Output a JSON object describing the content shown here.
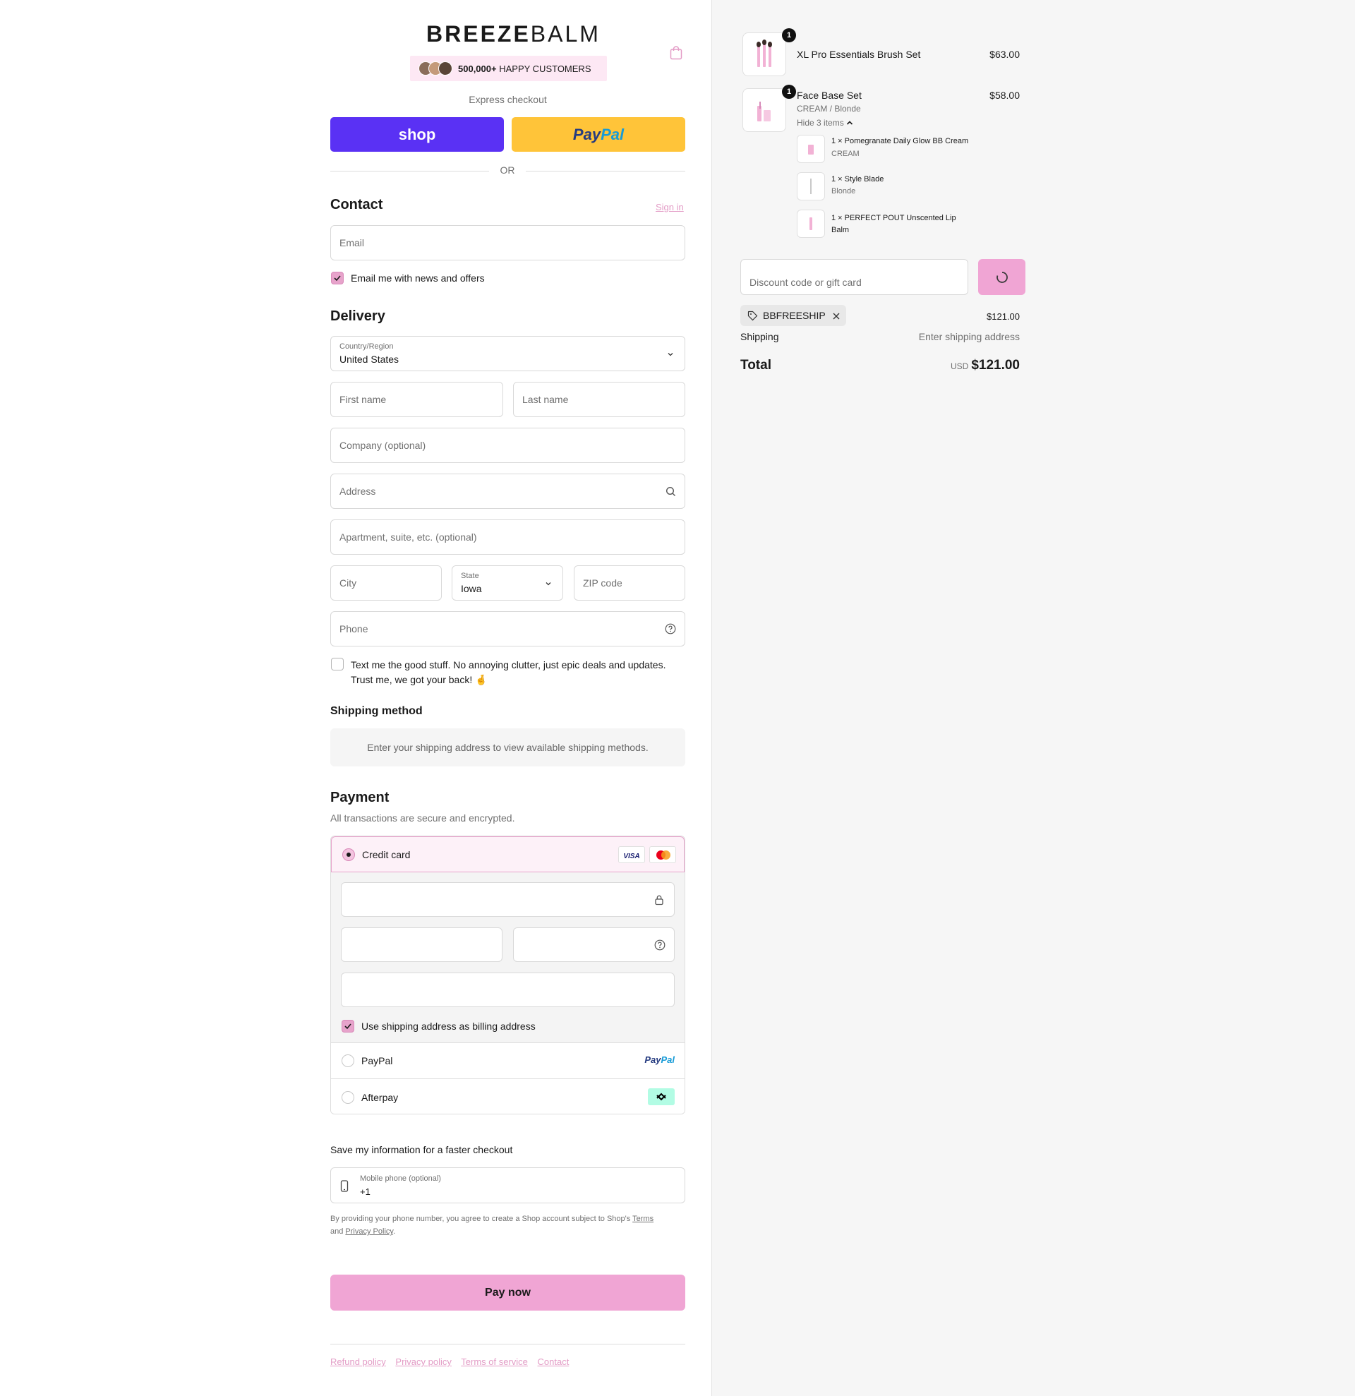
{
  "brand": {
    "logo_bold": "BREEZE",
    "logo_light": "BALM",
    "social_proof_count": "500,000+",
    "social_proof_text": "HAPPY CUSTOMERS"
  },
  "express": {
    "label": "Express checkout",
    "shop_label": "shop",
    "paypal_pay": "Pay",
    "paypal_pal": "Pal",
    "divider": "OR"
  },
  "contact": {
    "title": "Contact",
    "sign_in": "Sign in",
    "email_placeholder": "Email",
    "news_label": "Email me with news and offers"
  },
  "delivery": {
    "title": "Delivery",
    "country_label": "Country/Region",
    "country_value": "United States",
    "first_name": "First name",
    "last_name": "Last name",
    "company": "Company (optional)",
    "address": "Address",
    "apartment": "Apartment, suite, etc. (optional)",
    "city": "City",
    "state_label": "State",
    "state_value": "Iowa",
    "zip": "ZIP code",
    "phone": "Phone",
    "sms_text": "Text me the good stuff. No annoying clutter, just epic deals and updates. Trust me, we got your back! 🤞"
  },
  "shipping_method": {
    "title": "Shipping method",
    "message": "Enter your shipping address to view available shipping methods."
  },
  "payment": {
    "title": "Payment",
    "subtitle": "All transactions are secure and encrypted.",
    "credit_card": "Credit card",
    "visa": "VISA",
    "billing_label": "Use shipping address as billing address",
    "paypal": "PayPal",
    "afterpay": "Afterpay"
  },
  "save_info": {
    "title": "Save my information for a faster checkout",
    "mobile_label": "Mobile phone (optional)",
    "mobile_value": "+1",
    "disclaimer_1": "By providing your phone number, you agree to create a Shop account subject to Shop's",
    "terms": "Terms",
    "and": "and",
    "privacy": "Privacy Policy",
    "period": "."
  },
  "pay_now": "Pay now",
  "footer": {
    "refund": "Refund policy",
    "privacy": "Privacy policy",
    "terms": "Terms of service",
    "contact": "Contact"
  },
  "summary": {
    "items": [
      {
        "qty": "1",
        "name": "XL Pro Essentials Brush Set",
        "price": "$63.00"
      },
      {
        "qty": "1",
        "name": "Face Base Set",
        "variant": "CREAM / Blonde",
        "price": "$58.00",
        "toggle": "Hide 3 items"
      }
    ],
    "sub_items": [
      {
        "qty": "1 ×",
        "name": "Pomegranate Daily Glow BB Cream",
        "variant": "CREAM"
      },
      {
        "qty": "1 ×",
        "name": "Style Blade",
        "variant": "Blonde"
      },
      {
        "qty": "1 ×",
        "name": "PERFECT POUT Unscented Lip",
        "name2": "Balm"
      }
    ],
    "discount_placeholder": "Discount code or gift card",
    "code": "BBFREESHIP",
    "subtotal": "$121.00",
    "shipping_label": "Shipping",
    "shipping_value": "Enter shipping address",
    "total_label": "Total",
    "currency": "USD",
    "total": "$121.00"
  },
  "colors": {
    "accent": "#f0a5d4",
    "shop": "#5a31f4",
    "paypal": "#ffc439"
  }
}
